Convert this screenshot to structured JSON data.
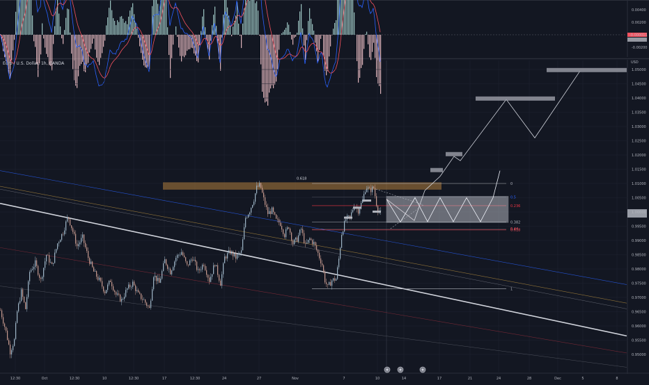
{
  "symbol_title": "Euro / U.S. Dollar, 1h, OANDA",
  "currency": "USD",
  "indicator_pane": {
    "type": "oscillator",
    "ticks": [
      "0.00400",
      "0.00200",
      "0.00000",
      "-0.00200"
    ],
    "current_value": "-0.000011",
    "colors": {
      "macd": "#2962ff",
      "signal": "#f7525f",
      "hist_up": "#b2dfdb",
      "hist_down": "#ffcdd2"
    }
  },
  "chart_data": {
    "type": "line",
    "title": "Euro / U.S. Dollar, 1h, OANDA",
    "ylabel": "USD",
    "ylim": [
      0.95,
      1.05
    ],
    "yticks": [
      "1.05000",
      "1.04500",
      "1.04000",
      "1.03500",
      "1.03000",
      "1.02500",
      "1.02000",
      "1.01500",
      "1.01000",
      "1.00500",
      "1.00000",
      "0.99500",
      "0.99000",
      "0.98500",
      "0.98000",
      "0.97500",
      "0.97000",
      "0.96500",
      "0.96000",
      "0.95500",
      "0.95000"
    ],
    "xticks": [
      "12:30",
      "Oct",
      "12:30",
      "10",
      "12:30",
      "17",
      "12:30",
      "24",
      "27",
      "Nov",
      "7",
      "10",
      "14",
      "17",
      "21",
      "24",
      "28",
      "Dec",
      "5",
      "8"
    ],
    "current_price_label": "",
    "series": [
      {
        "values": [
          {
            "x": 0,
            "y": 0.9655
          },
          {
            "x": 8,
            "y": 0.958
          },
          {
            "x": 14,
            "y": 0.951
          },
          {
            "x": 20,
            "y": 0.955
          },
          {
            "x": 24,
            "y": 0.965
          },
          {
            "x": 30,
            "y": 0.972
          },
          {
            "x": 36,
            "y": 0.966
          },
          {
            "x": 42,
            "y": 0.979
          },
          {
            "x": 50,
            "y": 0.982
          },
          {
            "x": 58,
            "y": 0.976
          },
          {
            "x": 66,
            "y": 0.985
          },
          {
            "x": 74,
            "y": 0.981
          },
          {
            "x": 82,
            "y": 0.989
          },
          {
            "x": 90,
            "y": 0.993
          },
          {
            "x": 97,
            "y": 0.9985
          },
          {
            "x": 103,
            "y": 0.994
          },
          {
            "x": 110,
            "y": 0.988
          },
          {
            "x": 118,
            "y": 0.991
          },
          {
            "x": 126,
            "y": 0.984
          },
          {
            "x": 134,
            "y": 0.979
          },
          {
            "x": 142,
            "y": 0.976
          },
          {
            "x": 150,
            "y": 0.972
          },
          {
            "x": 158,
            "y": 0.976
          },
          {
            "x": 166,
            "y": 0.971
          },
          {
            "x": 174,
            "y": 0.969
          },
          {
            "x": 182,
            "y": 0.973
          },
          {
            "x": 190,
            "y": 0.975
          },
          {
            "x": 198,
            "y": 0.971
          },
          {
            "x": 206,
            "y": 0.969
          },
          {
            "x": 214,
            "y": 0.966
          },
          {
            "x": 220,
            "y": 0.978
          },
          {
            "x": 228,
            "y": 0.975
          },
          {
            "x": 236,
            "y": 0.983
          },
          {
            "x": 244,
            "y": 0.979
          },
          {
            "x": 252,
            "y": 0.984
          },
          {
            "x": 260,
            "y": 0.986
          },
          {
            "x": 268,
            "y": 0.981
          },
          {
            "x": 276,
            "y": 0.984
          },
          {
            "x": 284,
            "y": 0.979
          },
          {
            "x": 292,
            "y": 0.982
          },
          {
            "x": 300,
            "y": 0.976
          },
          {
            "x": 308,
            "y": 0.982
          },
          {
            "x": 316,
            "y": 0.975
          },
          {
            "x": 322,
            "y": 0.984
          },
          {
            "x": 330,
            "y": 0.986
          },
          {
            "x": 338,
            "y": 0.984
          },
          {
            "x": 346,
            "y": 0.986
          },
          {
            "x": 352,
            "y": 0.998
          },
          {
            "x": 358,
            "y": 1.0005
          },
          {
            "x": 364,
            "y": 1.0045
          },
          {
            "x": 368,
            "y": 1.0085
          },
          {
            "x": 373,
            "y": 1.0095
          },
          {
            "x": 378,
            "y": 1.0045
          },
          {
            "x": 384,
            "y": 0.9995
          },
          {
            "x": 390,
            "y": 1.0005
          },
          {
            "x": 396,
            "y": 0.997
          },
          {
            "x": 402,
            "y": 0.996
          },
          {
            "x": 408,
            "y": 0.992
          },
          {
            "x": 414,
            "y": 0.995
          },
          {
            "x": 420,
            "y": 0.989
          },
          {
            "x": 426,
            "y": 0.9905
          },
          {
            "x": 432,
            "y": 0.994
          },
          {
            "x": 438,
            "y": 0.988
          },
          {
            "x": 444,
            "y": 0.9905
          },
          {
            "x": 450,
            "y": 0.989
          },
          {
            "x": 456,
            "y": 0.9855
          },
          {
            "x": 462,
            "y": 0.9815
          },
          {
            "x": 466,
            "y": 0.976
          },
          {
            "x": 470,
            "y": 0.9735
          },
          {
            "x": 476,
            "y": 0.976
          },
          {
            "x": 482,
            "y": 0.9765
          },
          {
            "x": 486,
            "y": 0.9835
          },
          {
            "x": 490,
            "y": 0.9925
          },
          {
            "x": 496,
            "y": 0.9975
          },
          {
            "x": 502,
            "y": 0.998
          },
          {
            "x": 508,
            "y": 1.0025
          },
          {
            "x": 514,
            "y": 1.0005
          },
          {
            "x": 520,
            "y": 1.004
          },
          {
            "x": 525,
            "y": 1.009
          },
          {
            "x": 530,
            "y": 1.0075
          },
          {
            "x": 536,
            "y": 1.0085
          },
          {
            "x": 541,
            "y": 1.0015
          },
          {
            "x": 546,
            "y": 0.9995
          }
        ]
      }
    ],
    "fibonacci": {
      "levels": [
        {
          "label": "0",
          "price": 1.01,
          "color": "#b2b5be"
        },
        {
          "label": "0.236",
          "price": 1.0022,
          "color": "#f23645"
        },
        {
          "label": "0.382",
          "price": 0.9964,
          "color": "#b2b5be"
        },
        {
          "label": "0.618",
          "price": 0.9937,
          "color": "#f7525f"
        },
        {
          "label": "1",
          "price": 0.973,
          "color": "#b2b5be"
        }
      ],
      "extra_labels": [
        "0.5",
        "0.44"
      ],
      "zone_label": "0.618"
    },
    "projection_path": [
      {
        "x": 555,
        "y": 1.0045
      },
      {
        "x": 595,
        "y": 0.997
      },
      {
        "x": 610,
        "y": 1.0075
      },
      {
        "x": 632,
        "y": 1.0125
      },
      {
        "x": 652,
        "y": 1.0195
      },
      {
        "x": 661,
        "y": 1.018
      },
      {
        "x": 727,
        "y": 1.0395
      },
      {
        "x": 768,
        "y": 1.026
      },
      {
        "x": 833,
        "y": 1.0495
      }
    ],
    "targets": [
      {
        "x1": 785,
        "x2": 900,
        "y": 1.0498
      },
      {
        "x1": 683,
        "x2": 797,
        "y": 1.0398
      },
      {
        "x1": 640,
        "x2": 664,
        "y": 1.0203
      },
      {
        "x1": 618,
        "x2": 636,
        "y": 1.0147
      }
    ],
    "markers": [
      "event-1",
      "event-2",
      "event-3"
    ]
  }
}
